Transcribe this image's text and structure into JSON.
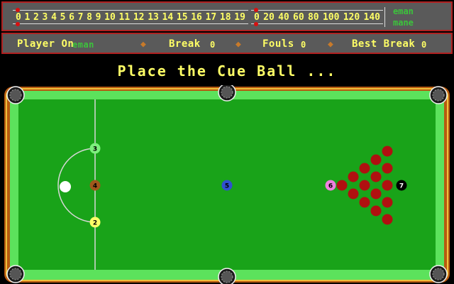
{
  "score_scale_left": {
    "ticks": [
      "0",
      "1",
      "2",
      "3",
      "4",
      "5",
      "6",
      "7",
      "8",
      "9",
      "10",
      "11",
      "12",
      "13",
      "14",
      "15",
      "16",
      "17",
      "18",
      "19"
    ]
  },
  "score_scale_right": {
    "ticks": [
      "0",
      "20",
      "40",
      "60",
      "80",
      "100",
      "120",
      "140"
    ]
  },
  "players": {
    "top": "eman",
    "bottom": "mane"
  },
  "status": {
    "player_on_label": "Player On",
    "player_on_value": "eman",
    "break_label": "Break",
    "break_value": "0",
    "fouls_label": "Fouls",
    "fouls_value": "0",
    "best_break_label": "Best Break",
    "best_break_value": "0",
    "separator": "◆"
  },
  "message": "Place the Cue Ball ...",
  "balls": {
    "cue": {
      "color": "#ffffff"
    },
    "yellow": {
      "number": "2",
      "color": "#ffff66"
    },
    "green": {
      "number": "3",
      "color": "#7cf07c"
    },
    "brown": {
      "number": "4",
      "color": "#a0581c"
    },
    "blue": {
      "number": "5",
      "color": "#3050d0"
    },
    "pink": {
      "number": "6",
      "color": "#f080e0"
    },
    "black": {
      "number": "7",
      "color": "#000000"
    },
    "red": {
      "color": "#b01010",
      "count": 15
    }
  },
  "colors": {
    "cloth": "#19a319",
    "cushion": "#5ce25c",
    "wood": "#b85a10",
    "panel": "#5a5a5a",
    "panel_border": "#b02020"
  }
}
